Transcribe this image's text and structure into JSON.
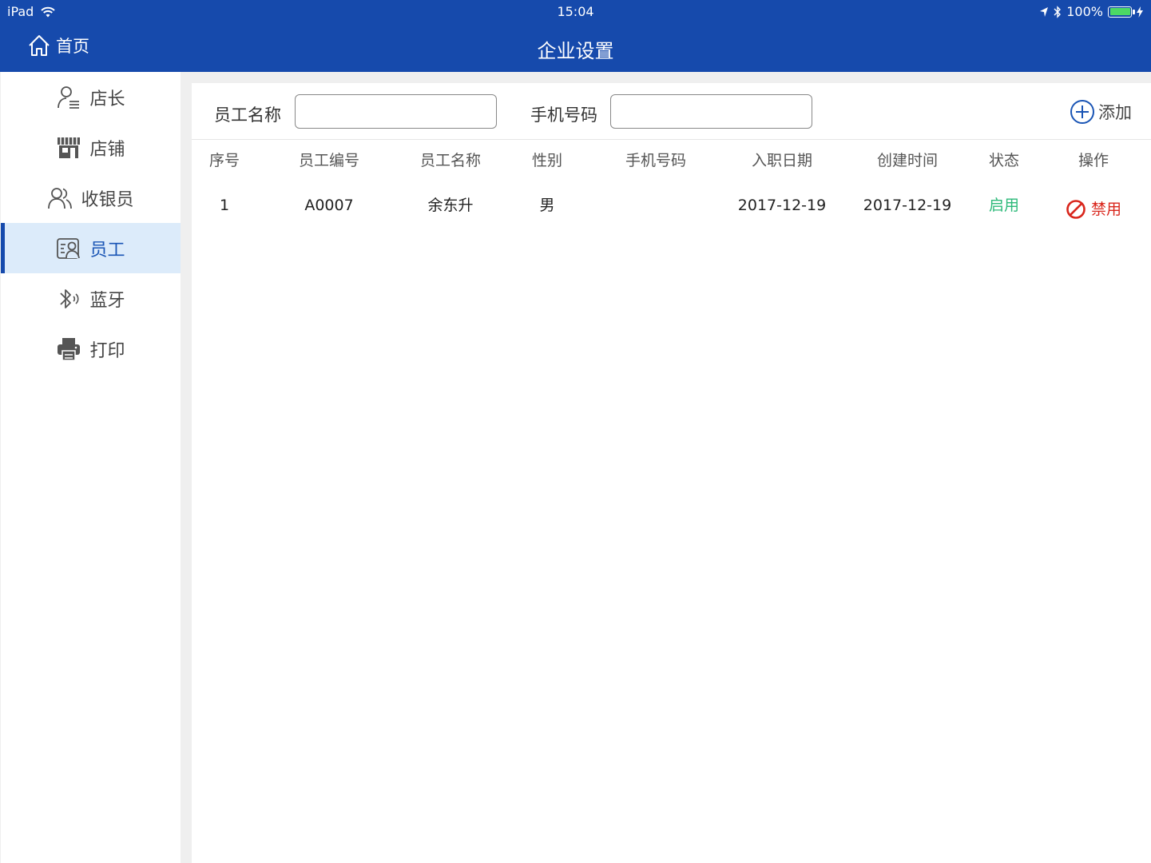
{
  "status_bar": {
    "device": "iPad",
    "time": "15:04",
    "battery": "100%"
  },
  "nav": {
    "home_label": "首页",
    "title": "企业设置"
  },
  "sidebar": {
    "items": [
      {
        "label": "店长",
        "icon": "manager-icon"
      },
      {
        "label": "店铺",
        "icon": "store-icon"
      },
      {
        "label": "收银员",
        "icon": "cashier-icon"
      },
      {
        "label": "员工",
        "icon": "employee-icon",
        "active": true
      },
      {
        "label": "蓝牙",
        "icon": "bluetooth-icon"
      },
      {
        "label": "打印",
        "icon": "printer-icon"
      }
    ]
  },
  "search": {
    "name_label": "员工名称",
    "name_value": "",
    "phone_label": "手机号码",
    "phone_value": "",
    "add_label": "添加"
  },
  "table": {
    "headers": [
      "序号",
      "员工编号",
      "员工名称",
      "性别",
      "手机号码",
      "入职日期",
      "创建时间",
      "状态",
      "操作"
    ],
    "rows": [
      {
        "index": "1",
        "code": "A0007",
        "name": "余东升",
        "gender": "男",
        "phone": "",
        "hire_date": "2017-12-19",
        "created": "2017-12-19",
        "status": "启用",
        "action": "禁用"
      }
    ]
  },
  "colors": {
    "nav_bg": "#164aac",
    "active_bg": "#dcebfa",
    "status_enabled": "#2cb979",
    "action_disable": "#d9261c"
  }
}
